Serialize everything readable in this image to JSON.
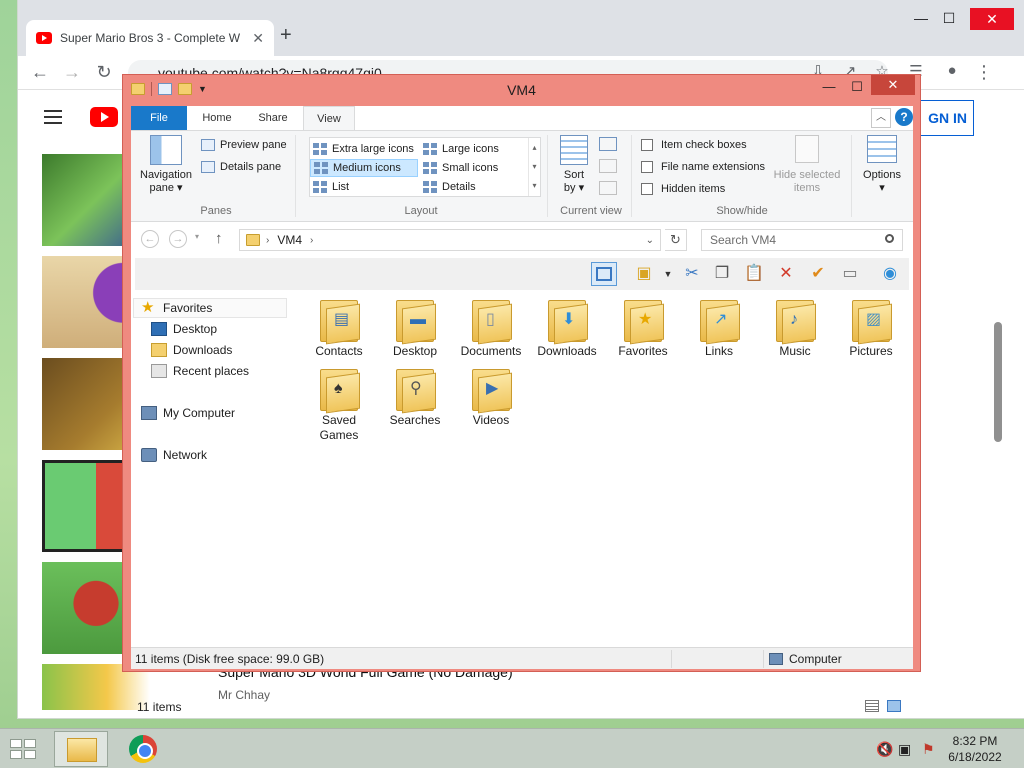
{
  "chrome": {
    "tab_title": "Super Mario Bros 3 - Complete W",
    "url": "youtube.com/watch?v=Na8rgq47gi0",
    "signin_label": "GN IN"
  },
  "youtube": {
    "video_title": "Super Mario 3D World Full Game (No Damage)",
    "channel": "Mr Chhay"
  },
  "explorer": {
    "title": "VM4",
    "ribbon_tabs": [
      "File",
      "Home",
      "Share",
      "View"
    ],
    "panes": {
      "navigation_pane": "Navigation",
      "navigation_pane2": "pane",
      "preview_pane": "Preview pane",
      "details_pane": "Details pane",
      "group_label": "Panes"
    },
    "layout": {
      "items": [
        "Extra large icons",
        "Large icons",
        "Medium icons",
        "Small icons",
        "List",
        "Details"
      ],
      "group_label": "Layout"
    },
    "current_view": {
      "sort_by": "Sort",
      "sort_by2": "by",
      "group_label": "Current view"
    },
    "show_hide": {
      "item_check_boxes": "Item check boxes",
      "file_name_extensions": "File name extensions",
      "hidden_items": "Hidden items",
      "hide_selected": "Hide selected",
      "hide_selected2": "items",
      "group_label": "Show/hide"
    },
    "options_label": "Options",
    "address": "VM4",
    "search_placeholder": "Search VM4",
    "nav": {
      "favorites": "Favorites",
      "desktop": "Desktop",
      "downloads": "Downloads",
      "recent_places": "Recent places",
      "my_computer": "My Computer",
      "network": "Network"
    },
    "files": [
      {
        "name": "Contacts",
        "icon": "contacts-folder-icon"
      },
      {
        "name": "Desktop",
        "icon": "desktop-folder-icon"
      },
      {
        "name": "Documents",
        "icon": "documents-folder-icon"
      },
      {
        "name": "Downloads",
        "icon": "downloads-folder-icon"
      },
      {
        "name": "Favorites",
        "icon": "favorites-folder-icon"
      },
      {
        "name": "Links",
        "icon": "links-folder-icon"
      },
      {
        "name": "Music",
        "icon": "music-folder-icon"
      },
      {
        "name": "Pictures",
        "icon": "pictures-folder-icon"
      },
      {
        "name": "Saved\nGames",
        "icon": "saved-games-folder-icon"
      },
      {
        "name": "Searches",
        "icon": "searches-folder-icon"
      },
      {
        "name": "Videos",
        "icon": "videos-folder-icon"
      }
    ],
    "item_count": "11 items",
    "status_free_space": "11 items (Disk free space: 99.0 GB)",
    "status_location": "Computer"
  },
  "taskbar": {
    "time": "8:32 PM",
    "date": "6/18/2022"
  },
  "colors": {
    "explorer_frame": "#ef8a80",
    "file_tab": "#1979ca",
    "selection": "#cce8ff"
  }
}
